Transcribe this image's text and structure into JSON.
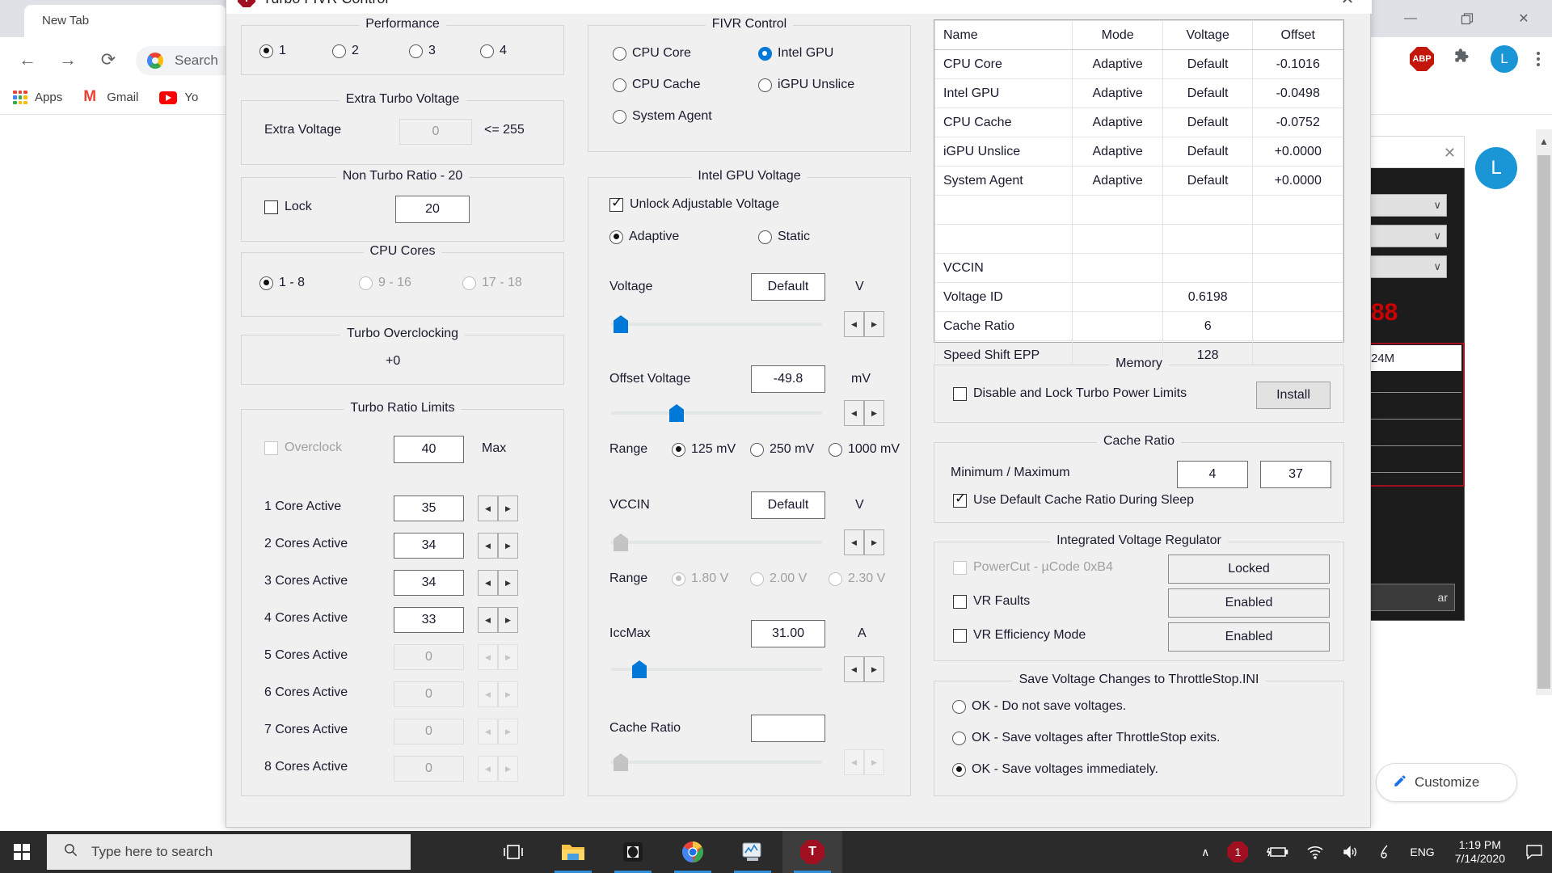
{
  "browser": {
    "tab_title": "New Tab",
    "omnibox_placeholder": "Search Google or type a URL",
    "omnibox_text": "Search",
    "bookmarks": [
      {
        "label": "Apps",
        "icon": "apps-grid-icon"
      },
      {
        "label": "Gmail",
        "icon": "gmail-icon"
      },
      {
        "label": "Yo",
        "icon": "youtube-icon"
      }
    ],
    "extensions": [
      {
        "name": "adblock-plus-icon",
        "label": "ABP"
      },
      {
        "name": "extensions-puzzle-icon",
        "label": "✦"
      }
    ],
    "profile_initial": "L",
    "menu_icon": "⋮",
    "window_controls": {
      "minimize": "—",
      "maximize": "❐",
      "close": "✕"
    },
    "customize_label": "Customize",
    "customize_icon": "pencil-icon"
  },
  "background_window": {
    "close_icon": "✕",
    "red_value": "88",
    "white_row_value": "24M",
    "clear_label": "ar",
    "chevron": "∨",
    "profile_initial": "L"
  },
  "dialog": {
    "title": "Turbo FIVR Control",
    "icon": "throttlestop-icon",
    "close_icon": "✕",
    "performance": {
      "title": "Performance",
      "options": [
        {
          "label": "1",
          "selected": true
        },
        {
          "label": "2",
          "selected": false
        },
        {
          "label": "3",
          "selected": false
        },
        {
          "label": "4",
          "selected": false
        }
      ]
    },
    "extra_turbo_voltage": {
      "title": "Extra Turbo Voltage",
      "label": "Extra Voltage",
      "value": "0",
      "suffix": "<= 255"
    },
    "non_turbo_ratio": {
      "title": "Non Turbo Ratio - 20",
      "lock_label": "Lock",
      "lock_checked": false,
      "value": "20"
    },
    "cpu_cores": {
      "title": "CPU Cores",
      "options": [
        {
          "label": "1 - 8",
          "selected": true,
          "enabled": true
        },
        {
          "label": "9 - 16",
          "selected": false,
          "enabled": false
        },
        {
          "label": "17 - 18",
          "selected": false,
          "enabled": false
        }
      ]
    },
    "turbo_overclocking": {
      "title": "Turbo Overclocking",
      "value": "+0"
    },
    "turbo_ratio_limits": {
      "title": "Turbo Ratio Limits",
      "overclock_label": "Overclock",
      "overclock_checked": false,
      "overclock_enabled": false,
      "max_value": "40",
      "max_label": "Max",
      "rows": [
        {
          "label": "1 Core Active",
          "value": "35",
          "enabled": true
        },
        {
          "label": "2 Cores Active",
          "value": "34",
          "enabled": true
        },
        {
          "label": "3 Cores Active",
          "value": "34",
          "enabled": true
        },
        {
          "label": "4 Cores Active",
          "value": "33",
          "enabled": true
        },
        {
          "label": "5 Cores Active",
          "value": "0",
          "enabled": false
        },
        {
          "label": "6 Cores Active",
          "value": "0",
          "enabled": false
        },
        {
          "label": "7 Cores Active",
          "value": "0",
          "enabled": false
        },
        {
          "label": "8 Cores Active",
          "value": "0",
          "enabled": false
        }
      ]
    },
    "fivr_control": {
      "title": "FIVR Control",
      "options": [
        {
          "label": "CPU Core",
          "selected": false
        },
        {
          "label": "Intel GPU",
          "selected": true
        },
        {
          "label": "CPU Cache",
          "selected": false
        },
        {
          "label": "iGPU Unslice",
          "selected": false
        },
        {
          "label": "System Agent",
          "selected": false
        }
      ]
    },
    "gpu_voltage": {
      "title": "Intel GPU Voltage",
      "unlock_label": "Unlock Adjustable Voltage",
      "unlock_checked": true,
      "mode_options": [
        {
          "label": "Adaptive",
          "selected": true
        },
        {
          "label": "Static",
          "selected": false
        }
      ],
      "voltage_label": "Voltage",
      "voltage_value": "Default",
      "voltage_unit": "V",
      "offset_label": "Offset Voltage",
      "offset_value": "-49.8",
      "offset_unit": "mV",
      "range_label": "Range",
      "range_options": [
        {
          "label": "125 mV",
          "selected": true
        },
        {
          "label": "250 mV",
          "selected": false
        },
        {
          "label": "1000 mV",
          "selected": false
        }
      ],
      "vccin_label": "VCCIN",
      "vccin_value": "Default",
      "vccin_unit": "V",
      "vccin_range_label": "Range",
      "vccin_range_options": [
        {
          "label": "1.80 V",
          "selected": true,
          "enabled": false
        },
        {
          "label": "2.00 V",
          "selected": false,
          "enabled": false
        },
        {
          "label": "2.30 V",
          "selected": false,
          "enabled": false
        }
      ],
      "iccmax_label": "IccMax",
      "iccmax_value": "31.00",
      "iccmax_unit": "A",
      "cache_ratio_label": "Cache Ratio",
      "cache_ratio_value": ""
    },
    "fivr_table": {
      "headers": [
        "Name",
        "Mode",
        "Voltage",
        "Offset"
      ],
      "rows": [
        {
          "name": "CPU Core",
          "mode": "Adaptive",
          "voltage": "Default",
          "offset": "-0.1016"
        },
        {
          "name": "Intel GPU",
          "mode": "Adaptive",
          "voltage": "Default",
          "offset": "-0.0498"
        },
        {
          "name": "CPU Cache",
          "mode": "Adaptive",
          "voltage": "Default",
          "offset": "-0.0752"
        },
        {
          "name": "iGPU Unslice",
          "mode": "Adaptive",
          "voltage": "Default",
          "offset": "+0.0000"
        },
        {
          "name": "System Agent",
          "mode": "Adaptive",
          "voltage": "Default",
          "offset": "+0.0000"
        },
        {
          "name": "",
          "mode": "",
          "voltage": "",
          "offset": ""
        },
        {
          "name": "",
          "mode": "",
          "voltage": "",
          "offset": ""
        },
        {
          "name": "VCCIN",
          "mode": "",
          "voltage": "",
          "offset": ""
        },
        {
          "name": "Voltage ID",
          "mode": "",
          "voltage": "0.6198",
          "offset": ""
        },
        {
          "name": "Cache Ratio",
          "mode": "",
          "voltage": "6",
          "offset": ""
        },
        {
          "name": "Speed Shift EPP",
          "mode": "",
          "voltage": "128",
          "offset": ""
        }
      ]
    },
    "memory": {
      "title": "Memory",
      "checkbox_label": "Disable and Lock Turbo Power Limits",
      "checked": false,
      "install_label": "Install"
    },
    "cache_ratio": {
      "title": "Cache Ratio",
      "minmax_label": "Minimum / Maximum",
      "min_value": "4",
      "max_value": "37",
      "sleep_label": "Use Default Cache Ratio During Sleep",
      "sleep_checked": true
    },
    "ivr": {
      "title": "Integrated Voltage Regulator",
      "rows": [
        {
          "label": "PowerCut  -  µCode 0xB4",
          "checked": false,
          "enabled": false,
          "button": "Locked"
        },
        {
          "label": "VR Faults",
          "checked": false,
          "enabled": true,
          "button": "Enabled"
        },
        {
          "label": "VR Efficiency Mode",
          "checked": false,
          "enabled": true,
          "button": "Enabled"
        }
      ]
    },
    "save_voltage": {
      "title": "Save Voltage Changes to ThrottleStop.INI",
      "options": [
        {
          "label": "OK - Do not save voltages.",
          "selected": false
        },
        {
          "label": "OK - Save voltages after ThrottleStop exits.",
          "selected": false
        },
        {
          "label": "OK - Save voltages immediately.",
          "selected": true
        }
      ]
    }
  },
  "taskbar": {
    "start_icon": "windows-logo-icon",
    "search_placeholder": "Type here to search",
    "search_icon": "search-icon",
    "apps": [
      {
        "name": "task-view-icon",
        "active": false,
        "running": false
      },
      {
        "name": "file-explorer-icon",
        "active": false,
        "running": true
      },
      {
        "name": "dolby-icon",
        "active": false,
        "running": true
      },
      {
        "name": "chrome-icon",
        "active": false,
        "running": true
      },
      {
        "name": "resource-monitor-icon",
        "active": false,
        "running": true
      },
      {
        "name": "throttlestop-icon",
        "active": true,
        "running": true
      }
    ],
    "tray": {
      "chevron": "∧",
      "badge": "1",
      "icons": [
        "battery-icon",
        "wifi-icon",
        "volume-icon",
        "pen-icon"
      ],
      "language": "ENG",
      "time": "1:19 PM",
      "date": "7/14/2020",
      "action_center": "notification-icon"
    }
  }
}
